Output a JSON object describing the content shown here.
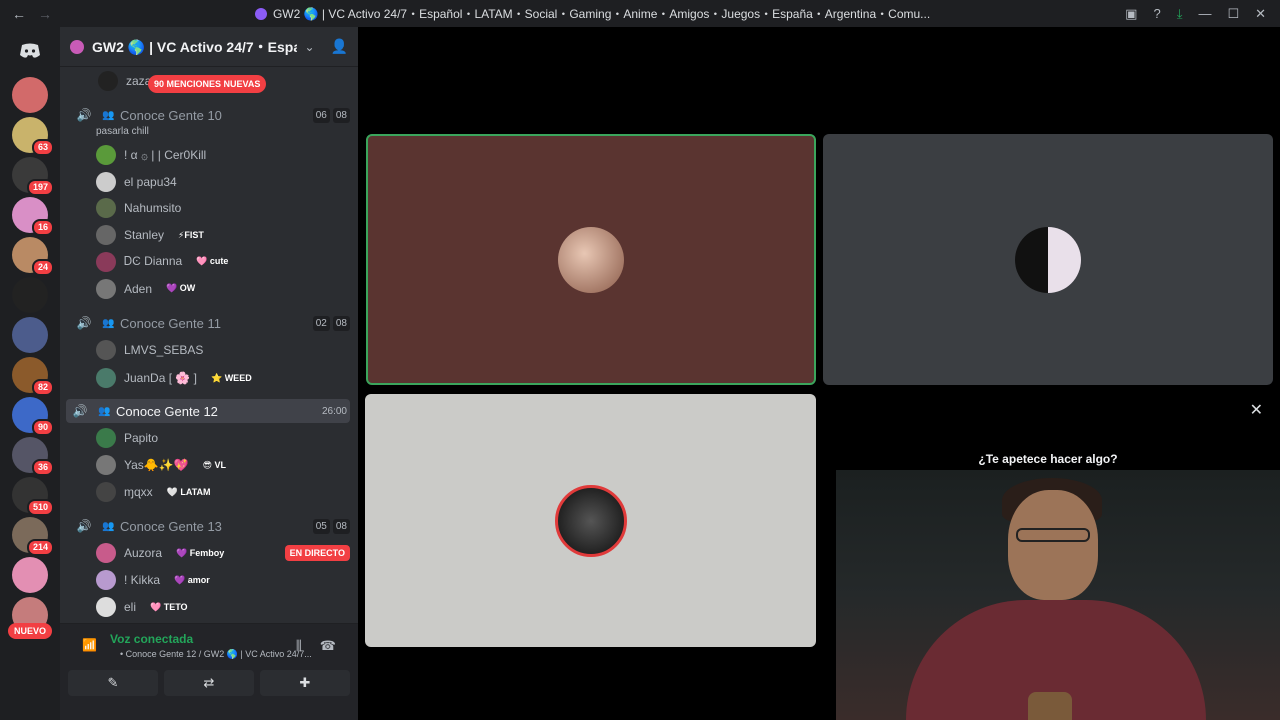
{
  "window": {
    "title": "GW2 🌎 | VC Activo 24/7・Español・LATAM・Social・Gaming・Anime・Amigos・Juegos・España・Argentina・Comu...",
    "back": "←",
    "forward": "→",
    "icons": [
      "inbox-icon",
      "help-icon",
      "download-icon",
      "minimize-icon",
      "maximize-icon",
      "close-icon"
    ],
    "minimize": "—",
    "maximize": "☐",
    "close": "✕"
  },
  "rail": {
    "badges": [
      "",
      "63",
      "197",
      "16",
      "24",
      "",
      "",
      "82",
      "90",
      "36",
      "510",
      "214",
      "",
      ""
    ],
    "colors": [
      "#d26a6a",
      "#c9b36b",
      "#3a3a3a",
      "#d98fc6",
      "#b98a64",
      "#222",
      "#4c5c8c",
      "#8b5a2b",
      "#3d69c8",
      "#556",
      "#333",
      "#7b6a5a",
      "#e38fb3",
      "#c57c7c"
    ],
    "nuevo": "NUEVO"
  },
  "server": {
    "name": "GW2 🌎 | VC Activo 24/7・Espa...",
    "mentions": "90 MENCIONES NUEVAS"
  },
  "channels": {
    "top_user": "zaza",
    "ch10": {
      "name": "Conoce Gente 10",
      "c1": "06",
      "c2": "08",
      "status": "pasarla chill",
      "users": [
        {
          "name": "! α ۞ | | Cer0Kill",
          "tag": "",
          "color": "#5a9a3a"
        },
        {
          "name": "el papu34",
          "tag": "",
          "color": "#ccc"
        },
        {
          "name": "Nahumsito",
          "tag": "",
          "color": "#5a6a4a"
        },
        {
          "name": "Stanley",
          "tag": "⚡FIST",
          "color": "#666"
        },
        {
          "name": "ᎠϾ Dianna",
          "tag": "🩷 cute",
          "color": "#8a3a5a"
        },
        {
          "name": "Aden",
          "tag": "💜 OW",
          "color": "#777"
        }
      ]
    },
    "ch11": {
      "name": "Conoce Gente 11",
      "c1": "02",
      "c2": "08",
      "users": [
        {
          "name": "LMVS_SEBAS",
          "tag": "",
          "color": "#555"
        },
        {
          "name": "JuanDa [ 🌸 ]",
          "tag": "⭐ WEED",
          "color": "#4a7a6a"
        }
      ]
    },
    "ch12": {
      "name": "Conoce Gente 12",
      "c1": "26:00",
      "users": [
        {
          "name": "Papito",
          "tag": "",
          "color": "#3a7a4a"
        },
        {
          "name": "Yas🐥✨💖",
          "tag": "😎 VL",
          "color": "#777"
        },
        {
          "name": "ɱɋxx",
          "tag": "🤍 LATAM",
          "color": "#444"
        }
      ]
    },
    "ch13": {
      "name": "Conoce Gente 13",
      "c1": "05",
      "c2": "08",
      "users": [
        {
          "name": "Auzora",
          "tag": "💜 Femboy",
          "color": "#c85b8b",
          "live": "EN DIRECTO"
        },
        {
          "name": "! Kikka",
          "tag": "💜 amor",
          "color": "#b89acf"
        },
        {
          "name": "eli",
          "tag": "🩷 TETO",
          "color": "#ddd"
        }
      ]
    }
  },
  "voice": {
    "title": "Voz conectada",
    "sub": "• Conoce Gente 12 / GW2 🌎 | VC Activo 24/7...",
    "btn1": "✎",
    "btn2": "⇄",
    "btn3": "✚"
  },
  "activity": {
    "title": "¿Te apetece hacer algo?",
    "close": "✕"
  }
}
